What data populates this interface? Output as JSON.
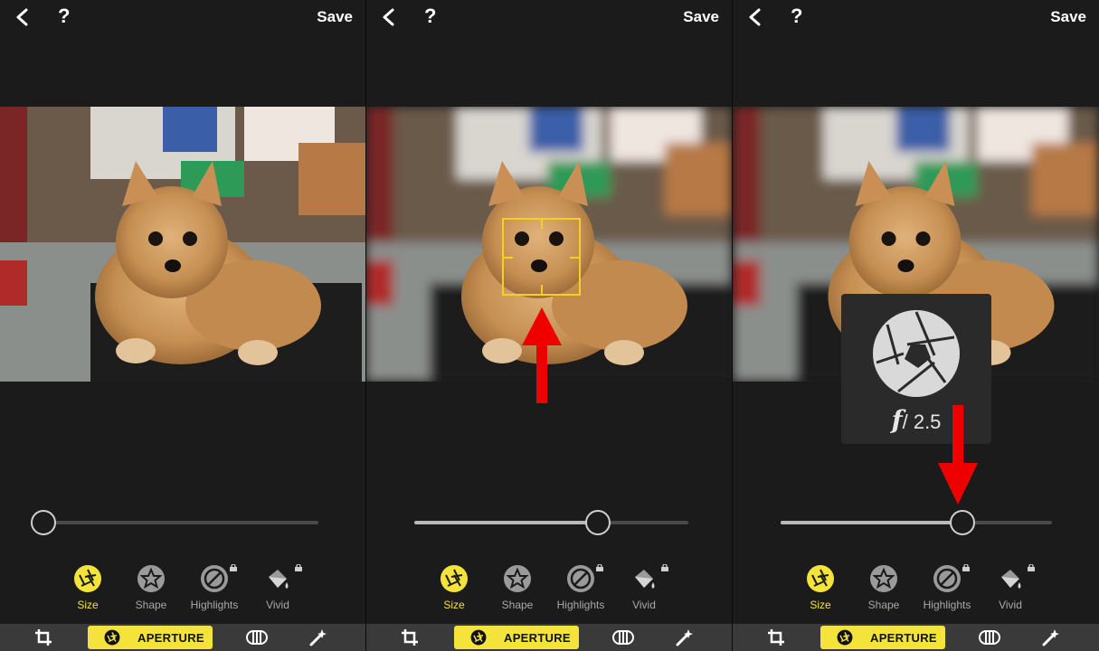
{
  "screens": [
    {
      "save_label": "Save",
      "help_label": "?",
      "slider_value": 0.0,
      "tools": [
        {
          "label": "Size"
        },
        {
          "label": "Shape"
        },
        {
          "label": "Highlights"
        },
        {
          "label": "Vivid"
        }
      ],
      "mode_label": "APERTURE"
    },
    {
      "save_label": "Save",
      "help_label": "?",
      "slider_value": 0.67,
      "tools": [
        {
          "label": "Size"
        },
        {
          "label": "Shape"
        },
        {
          "label": "Highlights"
        },
        {
          "label": "Vivid"
        }
      ],
      "mode_label": "APERTURE"
    },
    {
      "save_label": "Save",
      "help_label": "?",
      "slider_value": 0.67,
      "tools": [
        {
          "label": "Size"
        },
        {
          "label": "Shape"
        },
        {
          "label": "Highlights"
        },
        {
          "label": "Vivid"
        }
      ],
      "mode_label": "APERTURE",
      "aperture_popup": {
        "f_prefix": "f",
        "value": "/ 2.5"
      }
    }
  ],
  "colors": {
    "accent": "#f3e33b",
    "annotation_arrow": "#ee0000",
    "focus_box": "#f3d21f"
  }
}
